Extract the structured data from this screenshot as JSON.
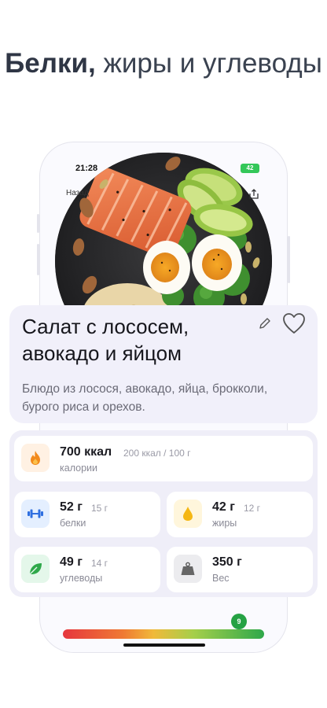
{
  "headline": {
    "bold": "Белки,",
    "rest": " жиры и углеводы"
  },
  "status_bar": {
    "time": "21:28",
    "battery": "42"
  },
  "nav": {
    "back_label": "Назад"
  },
  "dish": {
    "title": "Салат с лососем, авокадо и яйцом",
    "description": "Блюдо из лосося, авокадо, яйца, брокколи, бурого риса и орехов."
  },
  "nutrition": {
    "calories": {
      "value": "700 ккал",
      "per": "200 ккал / 100 г",
      "label": "калории"
    },
    "protein": {
      "value": "52 г",
      "per": "15 г",
      "label": "белки"
    },
    "fat": {
      "value": "42 г",
      "per": "12 г",
      "label": "жиры"
    },
    "carbs": {
      "value": "49 г",
      "per": "14 г",
      "label": "углеводы"
    },
    "weight": {
      "value": "350 г",
      "label": "Вес"
    }
  },
  "health_score": {
    "value": "9",
    "fraction": 0.88
  },
  "colors": {
    "accent_bg": "#f1f0fa",
    "calories_icon_bg": "#fff1e3",
    "protein_icon_bg": "#e4efff",
    "fat_icon_bg": "#fff6dc",
    "carbs_icon_bg": "#e4f7ea",
    "weight_icon_bg": "#ececef",
    "score_green": "#25a244"
  },
  "icons": [
    "fire-icon",
    "dumbbell-icon",
    "drop-icon",
    "leaf-icon",
    "weight-icon",
    "pencil-icon",
    "heart-icon",
    "share-icon"
  ]
}
